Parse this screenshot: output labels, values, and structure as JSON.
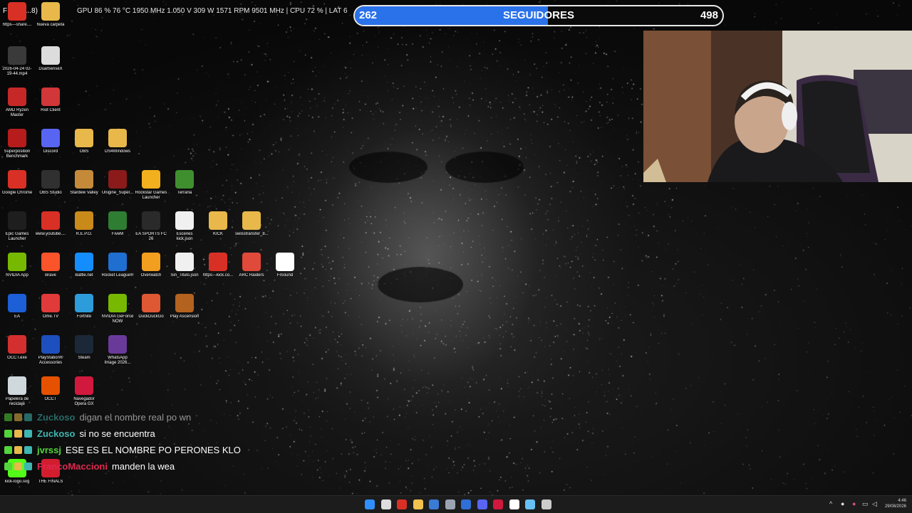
{
  "hw_overlay": {
    "left_fragment": "F 61  4(...8)",
    "stats": "GPU 86 % 76 °C 1950 MHz 1.050 V 309 W 1571 RPM 9501 MHz  |  CPU 72 %  |  LAT 6"
  },
  "follower_goal": {
    "current": "262",
    "label": "SEGUIDORES",
    "goal": "498",
    "progress": 0.526,
    "fill_color": "#2a72ea"
  },
  "desktop_icons": [
    {
      "label": "https---share....",
      "icon": "chrome-icon",
      "color": "#d93025"
    },
    {
      "label": "Nueva carpeta",
      "icon": "folder-icon",
      "color": "#e8b84a"
    },
    {
      "label": "2026-04-24 02-19-44.mp4",
      "icon": "video-file-icon",
      "color": "#3a3a3a"
    },
    {
      "label": "DualSenseX",
      "icon": "dualsense-icon",
      "color": "#dcdcdc"
    },
    {
      "label": "AMD Ryzen Master",
      "icon": "ryzen-icon",
      "color": "#c62828"
    },
    {
      "label": "Riot Client",
      "icon": "riot-icon",
      "color": "#d13639"
    },
    {
      "label": "Superposition Benchmark",
      "icon": "benchmark-icon",
      "color": "#b71c1c"
    },
    {
      "label": "Discord",
      "icon": "discord-icon",
      "color": "#5865f2"
    },
    {
      "label": "OBS",
      "icon": "folder-icon",
      "color": "#e8b84a"
    },
    {
      "label": "DS4Windows",
      "icon": "folder-icon",
      "color": "#e8b84a"
    },
    {
      "label": "Google Chrome",
      "icon": "chrome-icon",
      "color": "#d93025"
    },
    {
      "label": "OBS Studio",
      "icon": "obs-icon",
      "color": "#303030"
    },
    {
      "label": "Stardew Valley",
      "icon": "stardew-icon",
      "color": "#c48a3a"
    },
    {
      "label": "Unigine_Super...",
      "icon": "unigine-icon",
      "color": "#8b1a1a"
    },
    {
      "label": "Rockstar Games Launcher",
      "icon": "rockstar-icon",
      "color": "#f2b01e"
    },
    {
      "label": "Terraria",
      "icon": "terraria-icon",
      "color": "#3f8f2f"
    },
    {
      "label": "Epic Games Launcher",
      "icon": "epic-icon",
      "color": "#1e1e1e"
    },
    {
      "label": "www.youtube....",
      "icon": "chrome-icon",
      "color": "#d93025"
    },
    {
      "label": "R.E.P.O.",
      "icon": "repo-icon",
      "color": "#c98a1a"
    },
    {
      "label": "FiveM",
      "icon": "fivem-icon",
      "color": "#2e7d32"
    },
    {
      "label": "EA SPORTS FC 26",
      "icon": "fc26-icon",
      "color": "#2a2a2a"
    },
    {
      "label": "Escenes kick.json",
      "icon": "file-icon",
      "color": "#f0f0f0"
    },
    {
      "label": "KICK",
      "icon": "folder-icon",
      "color": "#e8b84a"
    },
    {
      "label": "swisstransfer_8...",
      "icon": "zip-folder-icon",
      "color": "#e8b84a"
    },
    {
      "label": "NVIDIA App",
      "icon": "nvidia-icon",
      "color": "#76b900"
    },
    {
      "label": "Brave",
      "icon": "brave-icon",
      "color": "#fb542b"
    },
    {
      "label": "Battle.net",
      "icon": "battlenet-icon",
      "color": "#148eff"
    },
    {
      "label": "Rocket League®",
      "icon": "rocket-league-icon",
      "color": "#1f6fd1"
    },
    {
      "label": "Overwatch",
      "icon": "overwatch-icon",
      "color": "#f29e1f"
    },
    {
      "label": "Sin_Titulo.json",
      "icon": "file-icon",
      "color": "#f0f0f0"
    },
    {
      "label": "https---kick.co...",
      "icon": "chrome-icon",
      "color": "#d93025"
    },
    {
      "label": "ARC Raiders",
      "icon": "arc-raiders-icon",
      "color": "#e04a3a"
    },
    {
      "label": "FiSound",
      "icon": "fisound-icon",
      "color": "#ffffff"
    },
    {
      "label": "EA",
      "icon": "ea-icon",
      "color": "#1c5fd6"
    },
    {
      "label": "Ome.TV",
      "icon": "ometv-icon",
      "color": "#e03a3a"
    },
    {
      "label": "Fortnite",
      "icon": "fortnite-icon",
      "color": "#2d9cdb"
    },
    {
      "label": "NVIDIA GeForce NOW",
      "icon": "geforce-now-icon",
      "color": "#76b900"
    },
    {
      "label": "DuckDuckGo",
      "icon": "duckduckgo-icon",
      "color": "#de5833"
    },
    {
      "label": "Play Ascension",
      "icon": "ascension-icon",
      "color": "#b4621f"
    },
    {
      "label": "OCCT.exe",
      "icon": "occt-icon",
      "color": "#d32f2f"
    },
    {
      "label": "PlayStation® Accessories",
      "icon": "playstation-icon",
      "color": "#1e4fbf"
    },
    {
      "label": "Steam",
      "icon": "steam-icon",
      "color": "#1b2838"
    },
    {
      "label": "WhatsApp Image 2026...",
      "icon": "image-file-icon",
      "color": "#6a3a9a"
    },
    {
      "label": "Papelera de reciclaje",
      "icon": "recycle-bin-icon",
      "color": "#cfd8dc"
    },
    {
      "label": "OCCT",
      "icon": "occt-icon",
      "color": "#e65100"
    },
    {
      "label": "Navegador Opera GX",
      "icon": "opera-gx-icon",
      "color": "#d0193c"
    },
    {
      "label": "kick-logo.svg",
      "icon": "kick-file-icon",
      "color": "#53fc18"
    },
    {
      "label": "THE FINALS",
      "icon": "the-finals-icon",
      "color": "#d11d2e"
    }
  ],
  "chat": [
    {
      "user": "Zuckoso",
      "user_color": "#3fb6b0",
      "message": "digan el nombre real po wn",
      "faded": true
    },
    {
      "user": "Zuckoso",
      "user_color": "#3fb6b0",
      "message": "si no se encuentra",
      "faded": false
    },
    {
      "user": "jvrssj",
      "user_color": "#53d43b",
      "message": "ESE ES EL NOMBRE PO PERONES KLO",
      "faded": false
    },
    {
      "user": "FrancoMaccioni",
      "user_color": "#e0284f",
      "message": "manden la wea",
      "faded": false
    }
  ],
  "taskbar": {
    "apps": [
      {
        "icon": "windows-start-icon",
        "color": "#2f8fff"
      },
      {
        "icon": "search-icon",
        "color": "#dddddd"
      },
      {
        "icon": "chrome-icon",
        "color": "#d93025"
      },
      {
        "icon": "file-explorer-icon",
        "color": "#f2c14e"
      },
      {
        "icon": "store-icon",
        "color": "#3a7bd5"
      },
      {
        "icon": "settings-icon",
        "color": "#9aa4b1"
      },
      {
        "icon": "mail-icon",
        "color": "#2f6fd6"
      },
      {
        "icon": "discord-icon",
        "color": "#5865f2"
      },
      {
        "icon": "opera-gx-icon",
        "color": "#d0193c"
      },
      {
        "icon": "fisound-icon",
        "color": "#ffffff"
      },
      {
        "icon": "steam-icon",
        "color": "#66c0f4"
      },
      {
        "icon": "obs-icon",
        "color": "#cccccc"
      }
    ],
    "tray_chevron": "^",
    "time": "4:46",
    "date": "29/08/2026"
  }
}
